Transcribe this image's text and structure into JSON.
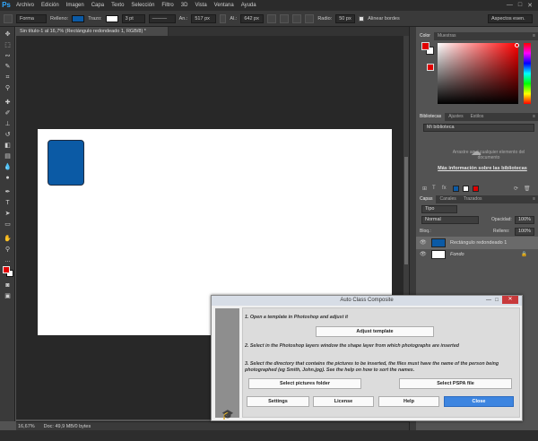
{
  "app": {
    "logo": "Ps"
  },
  "menu": [
    "Archivo",
    "Edición",
    "Imagen",
    "Capa",
    "Texto",
    "Selección",
    "Filtro",
    "3D",
    "Vista",
    "Ventana",
    "Ayuda"
  ],
  "window_controls": {
    "minimize": "—",
    "maximize": "□",
    "close": "✕"
  },
  "options_bar": {
    "shape_mode": "Forma",
    "fill_label": "Relleno:",
    "stroke_label": "Trazo:",
    "stroke_width": "3 pt",
    "width_label": "An.:",
    "width_value": "517 px",
    "height_label": "Al.:",
    "height_value": "642 px",
    "radius_label": "Radio:",
    "radius_value": "50 px",
    "align_edges": "Alinear bordes",
    "workspace": "Aspectos esen.",
    "fill_color": "#0b5aa5",
    "stroke_color": "#ffffff"
  },
  "document": {
    "tab_title": "Sin título-1 al 16,7% (Rectángulo redondeado 1, RGB/8) *",
    "zoom": "16,67%",
    "doc_info": "Doc: 49,9 MB/0 bytes",
    "shape_color": "#0b5aa5"
  },
  "panels": {
    "color": {
      "tabs": [
        "Color",
        "Muestras"
      ],
      "fg": "#e10000",
      "bg": "#ffffff"
    },
    "libraries": {
      "tabs": [
        "Bibliotecas",
        "Ajustes",
        "Estilos"
      ],
      "library_name": "Mi biblioteca",
      "drop_hint": "Arrastre aquí cualquier elemento del documento",
      "more_info": "Más información sobre las bibliotecas",
      "swatches": [
        "#0b5aa5",
        "#e10000"
      ]
    },
    "layers": {
      "tabs": [
        "Capas",
        "Canales",
        "Trazados"
      ],
      "filter_kind": "Tipo",
      "blend_mode": "Normal",
      "opacity_label": "Opacidad:",
      "opacity_value": "100%",
      "lock_label": "Bloq.:",
      "fill_label": "Relleno:",
      "fill_value": "100%",
      "items": [
        {
          "name": "Rectángulo redondeado 1"
        },
        {
          "name": "Fondo"
        }
      ]
    }
  },
  "dialog": {
    "title": "Auto Class Composite",
    "step1": "1. Open a template in Photoshop and adjust it",
    "adjust_button": "Adjust template",
    "step2": "2. Select in the Photoshop layers window the shape layer from which photographs are inserted",
    "step3": "3. Select the directory that contains the pictures to be inserted, the files must have the name of the person being photographed (eg Smith, John.jpg). See the help on how to sort the names.",
    "select_pictures_button": "Select pictures folder",
    "select_pspa_button": "Select PSPA file",
    "settings_button": "Settings",
    "license_button": "License",
    "help_button": "Help",
    "close_button": "Close"
  }
}
